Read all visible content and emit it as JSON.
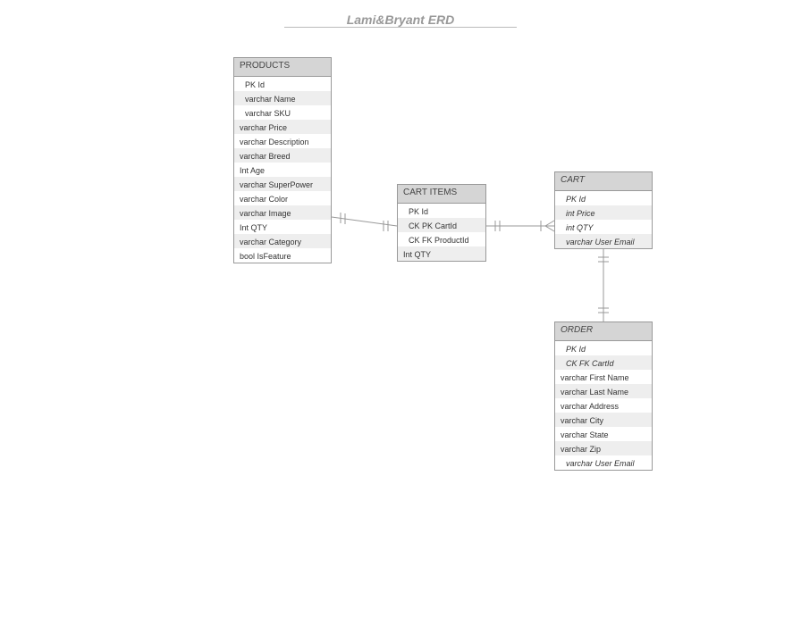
{
  "title": "Lami&Bryant ERD",
  "entities": {
    "products": {
      "name": "PRODUCTS",
      "rows": [
        {
          "text": "PK Id",
          "alt": false,
          "indent": true,
          "italic": false
        },
        {
          "text": "varchar Name",
          "alt": true,
          "indent": true,
          "italic": false
        },
        {
          "text": "varchar SKU",
          "alt": false,
          "indent": true,
          "italic": false
        },
        {
          "text": "varchar Price",
          "alt": true,
          "indent": false,
          "italic": false
        },
        {
          "text": "varchar Description",
          "alt": false,
          "indent": false,
          "italic": false
        },
        {
          "text": "varchar Breed",
          "alt": true,
          "indent": false,
          "italic": false
        },
        {
          "text": "Int Age",
          "alt": false,
          "indent": false,
          "italic": false
        },
        {
          "text": "varchar SuperPower",
          "alt": true,
          "indent": false,
          "italic": false
        },
        {
          "text": "varchar Color",
          "alt": false,
          "indent": false,
          "italic": false
        },
        {
          "text": "varchar Image",
          "alt": true,
          "indent": false,
          "italic": false
        },
        {
          "text": "Int QTY",
          "alt": false,
          "indent": false,
          "italic": false
        },
        {
          "text": "varchar Category",
          "alt": true,
          "indent": false,
          "italic": false
        },
        {
          "text": "bool IsFeature",
          "alt": false,
          "indent": false,
          "italic": false
        }
      ]
    },
    "cartitems": {
      "name": "CART ITEMS",
      "rows": [
        {
          "text": "PK Id",
          "alt": false,
          "indent": true,
          "italic": false
        },
        {
          "text": "CK PK CartId",
          "alt": true,
          "indent": true,
          "italic": false
        },
        {
          "text": "CK  FK ProductId",
          "alt": false,
          "indent": true,
          "italic": false
        },
        {
          "text": "Int QTY",
          "alt": true,
          "indent": false,
          "italic": false
        }
      ]
    },
    "cart": {
      "name": "CART",
      "rows": [
        {
          "text": "PK  Id",
          "alt": false,
          "indent": true,
          "italic": true
        },
        {
          "text": "int Price",
          "alt": true,
          "indent": true,
          "italic": true
        },
        {
          "text": "int QTY",
          "alt": false,
          "indent": true,
          "italic": true
        },
        {
          "text": "varchar User Email",
          "alt": true,
          "indent": true,
          "italic": true
        }
      ]
    },
    "order": {
      "name": "ORDER",
      "rows": [
        {
          "text": "PK Id",
          "alt": false,
          "indent": true,
          "italic": true
        },
        {
          "text": "CK FK CartId",
          "alt": true,
          "indent": true,
          "italic": true
        },
        {
          "text": "varchar First Name",
          "alt": false,
          "indent": false,
          "italic": false
        },
        {
          "text": "varchar Last Name",
          "alt": true,
          "indent": false,
          "italic": false
        },
        {
          "text": "varchar Address",
          "alt": false,
          "indent": false,
          "italic": false
        },
        {
          "text": "varchar City",
          "alt": true,
          "indent": false,
          "italic": false
        },
        {
          "text": "varchar State",
          "alt": false,
          "indent": false,
          "italic": false
        },
        {
          "text": "varchar Zip",
          "alt": true,
          "indent": false,
          "italic": false
        },
        {
          "text": "varchar User Email",
          "alt": false,
          "indent": true,
          "italic": true
        }
      ]
    }
  }
}
